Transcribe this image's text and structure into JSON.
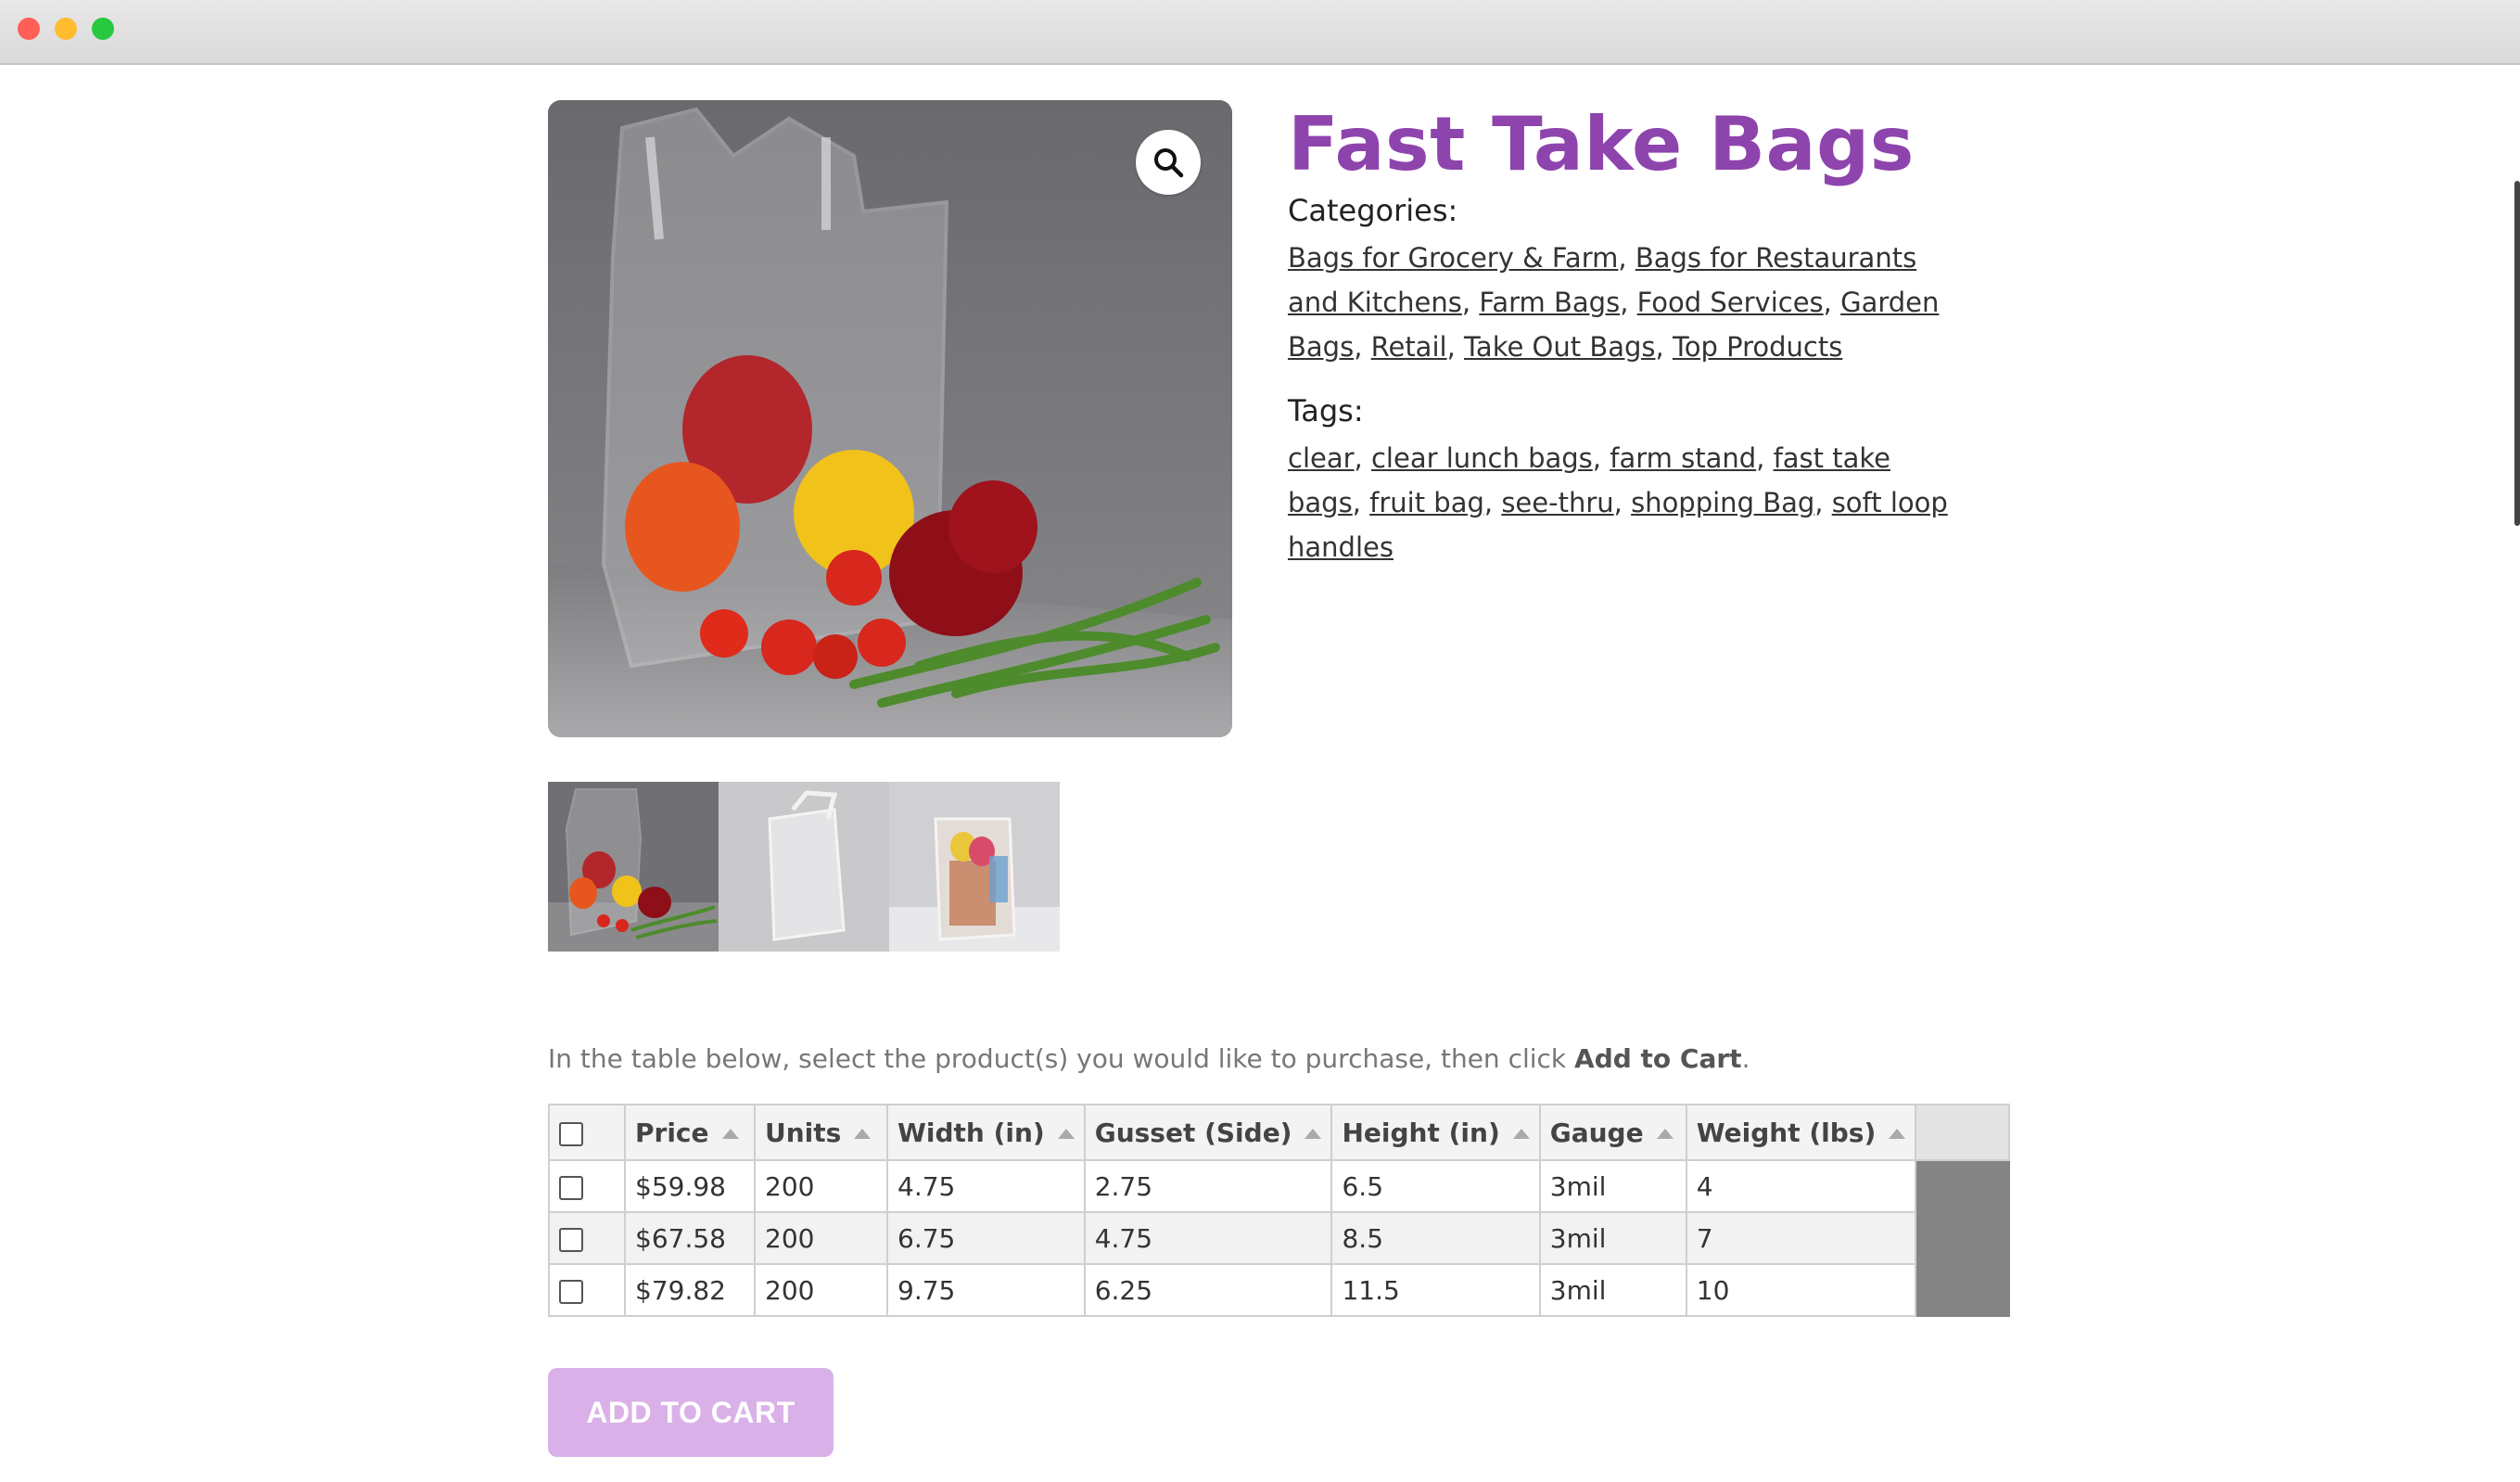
{
  "window": {
    "controls": [
      "close",
      "minimize",
      "zoom"
    ]
  },
  "product": {
    "title": "Fast Take Bags",
    "categories_label": "Categories:",
    "categories": [
      "Bags for Grocery & Farm",
      "Bags for Restaurants and Kitchens",
      "Farm Bags",
      "Food Services",
      "Garden Bags",
      "Retail",
      "Take Out Bags",
      "Top Products"
    ],
    "tags_label": "Tags:",
    "tags": [
      "clear",
      "clear lunch bags",
      "farm stand",
      "fast take bags",
      "fruit bag",
      "see-thru",
      "shopping Bag",
      "soft loop handles"
    ],
    "zoom_icon": "magnifier-icon",
    "thumbnail_count": 3
  },
  "purchase": {
    "instruction_prefix": "In the table below, select the product(s) you would like to purchase, then click ",
    "instruction_bold": "Add to Cart",
    "instruction_suffix": ".",
    "columns": [
      "Price",
      "Units",
      "Width (in)",
      "Gusset (Side)",
      "Height (in)",
      "Gauge",
      "Weight (lbs)"
    ],
    "rows": [
      [
        "$59.98",
        "200",
        "4.75",
        "2.75",
        "6.5",
        "3mil",
        "4"
      ],
      [
        "$67.58",
        "200",
        "6.75",
        "4.75",
        "8.5",
        "3mil",
        "7"
      ],
      [
        "$79.82",
        "200",
        "9.75",
        "6.25",
        "11.5",
        "3mil",
        "10"
      ]
    ],
    "add_to_cart_label": "ADD TO CART"
  },
  "colors": {
    "title": "#8e44ad",
    "button": "#d9b1e8"
  }
}
